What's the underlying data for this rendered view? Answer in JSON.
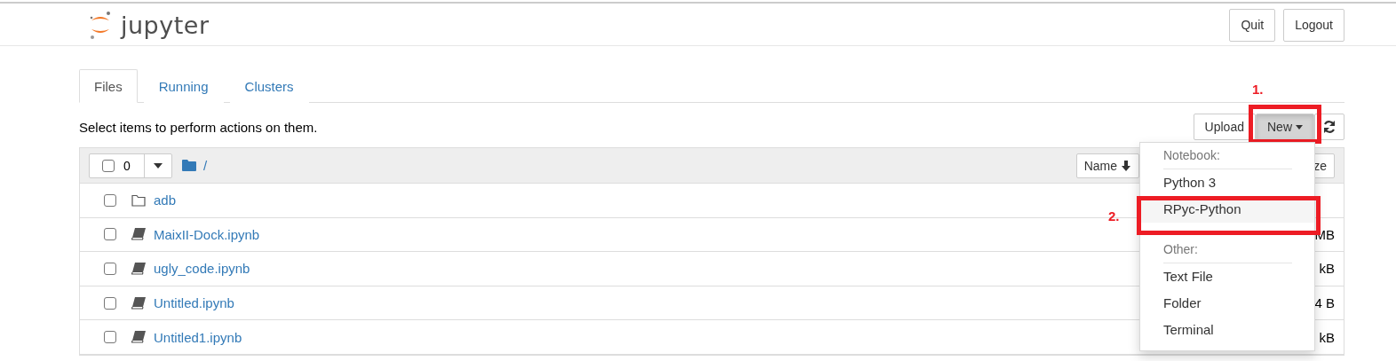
{
  "header": {
    "logo_text": "jupyter",
    "buttons": [
      "Quit",
      "Logout"
    ]
  },
  "tabs": [
    {
      "label": "Files",
      "selected": true
    },
    {
      "label": "Running",
      "selected": false
    },
    {
      "label": "Clusters",
      "selected": false
    }
  ],
  "toolbar": {
    "hint": "Select items to perform actions on them.",
    "upload": "Upload",
    "new": "New",
    "new_menu_open": true,
    "new_mark": "1."
  },
  "list_header": {
    "select_all_checked": false,
    "selected_count": "0",
    "path": "/",
    "sort_button": "Name",
    "column_3": "ze"
  },
  "rows": [
    {
      "kind": "folder",
      "name": "adb",
      "checked": false
    },
    {
      "kind": "notebook",
      "name": "MaixII-Dock.ipynb",
      "size": "MB",
      "checked": false
    },
    {
      "kind": "notebook",
      "name": "ugly_code.ipynb",
      "size": "kB",
      "checked": false
    },
    {
      "kind": "notebook",
      "name": "Untitled.ipynb",
      "size": "4 B",
      "checked": false
    },
    {
      "kind": "notebook",
      "name": "Untitled1.ipynb",
      "size": "kB",
      "checked": false
    }
  ],
  "new_menu": {
    "selected_mark": "2.",
    "sections": [
      {
        "heading": "Notebook:",
        "items": [
          {
            "label": "Python 3",
            "selected": false
          },
          {
            "label": "RPyc-Python",
            "selected": true
          }
        ]
      },
      {
        "heading": "Other:",
        "items": [
          {
            "label": "Text File",
            "selected": false
          },
          {
            "label": "Folder",
            "selected": false
          },
          {
            "label": "Terminal",
            "selected": false
          }
        ]
      }
    ]
  }
}
